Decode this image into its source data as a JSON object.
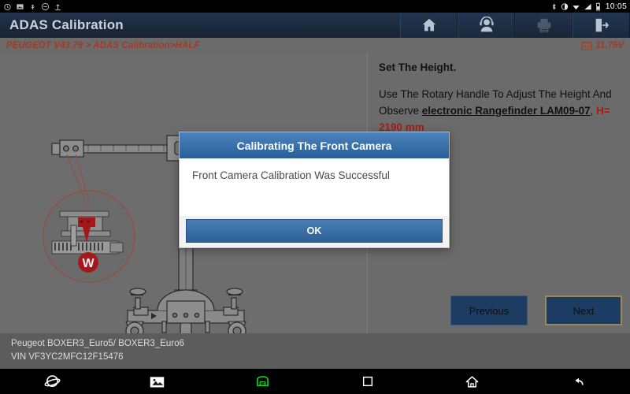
{
  "statusbar": {
    "time": "10:05",
    "left_icons": [
      "alarm-icon",
      "screenshot-icon",
      "usb-icon",
      "silent-icon",
      "upload-icon"
    ],
    "right_icons": [
      "bluetooth-icon",
      "rotation-lock-icon",
      "wifi-icon",
      "cellular-signal-icon",
      "battery-icon"
    ]
  },
  "titlebar": {
    "title": "ADAS Calibration",
    "actions": [
      {
        "name": "home-button",
        "icon": "home-icon",
        "enabled": true
      },
      {
        "name": "support-button",
        "icon": "headset-icon",
        "enabled": true
      },
      {
        "name": "print-button",
        "icon": "printer-icon",
        "enabled": false
      },
      {
        "name": "exit-button",
        "icon": "exit-icon",
        "enabled": true
      }
    ]
  },
  "breadcrumb": {
    "path": "PEUGEOT V43.79 > ADAS Calibration>HALF",
    "voltage": "11.75V",
    "voltage_icon": "battery-voltage-icon",
    "accent_color": "#a33a22"
  },
  "instructions": {
    "title": "Set The Height.",
    "line1_pre": "Use The Rotary Handle To Adjust The Height And Observe ",
    "device": "electronic Rangefinder LAM09-07",
    "comma": ", ",
    "measure_label": "H= ",
    "measure_value": "2190 mm"
  },
  "diagram": {
    "name": "adas-calibration-frame-diagram",
    "detail_marker": "W"
  },
  "nav": {
    "previous_label": "Previous",
    "next_label": "Next"
  },
  "dialog": {
    "title": "Calibrating The Front Camera",
    "message": "Front Camera Calibration Was Successful",
    "ok_label": "OK",
    "header_color": "#2a5f99"
  },
  "footer": {
    "vehicle": "Peugeot BOXER3_Euro5/ BOXER3_Euro6",
    "vin": "VIN VF3YC2MFC12F15476"
  },
  "androidnav": {
    "items": [
      "browser-icon",
      "gallery-icon",
      "vci-icon",
      "recents-icon",
      "home-icon",
      "back-icon"
    ],
    "vci_color": "#12cf26"
  }
}
